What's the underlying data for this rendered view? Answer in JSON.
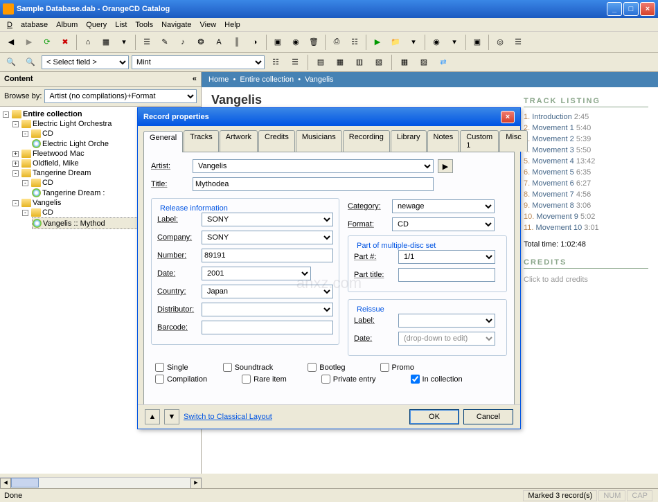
{
  "window": {
    "title": "Sample Database.dab - OrangeCD Catalog"
  },
  "menu": {
    "database": "Database",
    "album": "Album",
    "query": "Query",
    "list": "List",
    "tools": "Tools",
    "navigate": "Navigate",
    "view": "View",
    "help": "Help"
  },
  "searchbar": {
    "select_field": "< Select field >",
    "filter_value": "Mint"
  },
  "sidebar": {
    "header": "Content",
    "browse_label": "Browse by:",
    "browse_value": "Artist (no compilations)+Format",
    "nodes": {
      "root": "Entire collection",
      "elo": "Electric Light Orchestra",
      "cd": "CD",
      "elo_item": "Electric Light Orche",
      "fleetwood": "Fleetwood Mac",
      "oldfield": "Oldfield, Mike",
      "tangerine": "Tangerine Dream",
      "tangerine_item": "Tangerine Dream :",
      "vangelis": "Vangelis",
      "vangelis_item": "Vangelis :: Mythod"
    }
  },
  "breadcrumb": {
    "home": "Home",
    "collection": "Entire collection",
    "artist": "Vangelis"
  },
  "page": {
    "artist_heading": "Vangelis"
  },
  "track_listing": {
    "header": "TRACK LISTING",
    "tracks": [
      {
        "n": "1.",
        "name": "Introduction",
        "dur": "2:45"
      },
      {
        "n": "2.",
        "name": "Movement 1",
        "dur": "5:40"
      },
      {
        "n": "3.",
        "name": "Movement 2",
        "dur": "5:39"
      },
      {
        "n": "4.",
        "name": "Movement 3",
        "dur": "5:50"
      },
      {
        "n": "5.",
        "name": "Movement 4",
        "dur": "13:42"
      },
      {
        "n": "6.",
        "name": "Movement 5",
        "dur": "6:35"
      },
      {
        "n": "7.",
        "name": "Movement 6",
        "dur": "6:27"
      },
      {
        "n": "8.",
        "name": "Movement 7",
        "dur": "4:56"
      },
      {
        "n": "9.",
        "name": "Movement 8",
        "dur": "3:06"
      },
      {
        "n": "10.",
        "name": "Movement 9",
        "dur": "5:02"
      },
      {
        "n": "11.",
        "name": "Movement 10",
        "dur": "3:01"
      }
    ],
    "total_label": "Total time:",
    "total_value": "1:02:48"
  },
  "credits": {
    "header": "CREDITS",
    "placeholder": "Click to add credits"
  },
  "dialog": {
    "title": "Record properties",
    "tabs": [
      "General",
      "Tracks",
      "Artwork",
      "Credits",
      "Musicians",
      "Recording",
      "Library",
      "Notes",
      "Custom 1",
      "Misc"
    ],
    "artist_label": "Artist:",
    "artist_value": "Vangelis",
    "title_label": "Title:",
    "title_value": "Mythodea",
    "release_legend": "Release information",
    "label_label": "Label:",
    "label_value": "SONY",
    "company_label": "Company:",
    "company_value": "SONY",
    "number_label": "Number:",
    "number_value": "89191",
    "date_label": "Date:",
    "date_value": "2001",
    "country_label": "Country:",
    "country_value": "Japan",
    "distributor_label": "Distributor:",
    "distributor_value": "",
    "barcode_label": "Barcode:",
    "barcode_value": "",
    "category_label": "Category:",
    "category_value": "newage",
    "format_label": "Format:",
    "format_value": "CD",
    "multidisc_legend": "Part of multiple-disc set",
    "partnum_label": "Part #:",
    "partnum_value": "1/1",
    "parttitle_label": "Part title:",
    "parttitle_value": "",
    "reissue_legend": "Reissue",
    "reissue_label_label": "Label:",
    "reissue_label_value": "",
    "reissue_date_label": "Date:",
    "reissue_date_placeholder": "(drop-down to edit)",
    "chk_single": "Single",
    "chk_soundtrack": "Soundtrack",
    "chk_bootleg": "Bootleg",
    "chk_promo": "Promo",
    "chk_compilation": "Compilation",
    "chk_rare": "Rare item",
    "chk_private": "Private entry",
    "chk_incollection": "In collection",
    "switch_link": "Switch to Classical Layout",
    "ok": "OK",
    "cancel": "Cancel"
  },
  "statusbar": {
    "left": "Done",
    "marked": "Marked 3 record(s)",
    "num": "NUM",
    "cap": "CAP"
  }
}
